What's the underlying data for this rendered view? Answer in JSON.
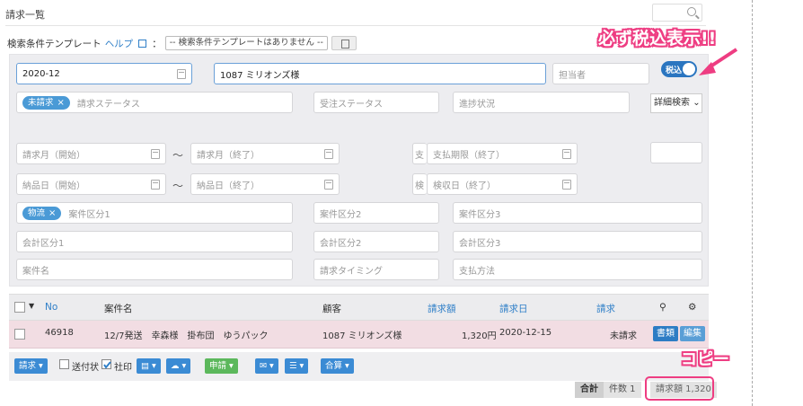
{
  "page": {
    "title": "請求一覧"
  },
  "template": {
    "label": "検索条件テンプレート",
    "help": "ヘルプ",
    "colon": "：",
    "select_value": "-- 検索条件テンプレートはありません --"
  },
  "filters": {
    "month": "2020-12",
    "customer": "1087 ミリオンズ様",
    "assignee_ph": "担当者",
    "status_tag": "未請求",
    "status_ph": "請求ステータス",
    "order_status_ph": "受注ステータス",
    "progress_ph": "進捗状況",
    "month_from_ph": "請求月（開始）",
    "month_to_ph": "請求月（終了）",
    "pay_cut": "支",
    "pay_due_ph": "支払期限（終了）",
    "delivery_from_ph": "納品日（開始）",
    "delivery_to_ph": "納品日（終了）",
    "inspect_cut": "検",
    "inspect_ph": "検収日（終了）",
    "category_tag": "物流",
    "cat1_ph": "案件区分1",
    "cat2_ph": "案件区分2",
    "cat3_ph": "案件区分3",
    "acc1_ph": "会計区分1",
    "acc2_ph": "会計区分2",
    "acc3_ph": "会計区分3",
    "name_ph": "案件名",
    "timing_ph": "請求タイミング",
    "payment_ph": "支払方法",
    "tilde": "〜",
    "tag_close": "×"
  },
  "tax_toggle": {
    "label": "税込"
  },
  "advanced": {
    "label": "詳細検索"
  },
  "callouts": {
    "tax": "必ず税込表示!!",
    "copy": "コピー"
  },
  "table": {
    "headers": {
      "no": "No",
      "name": "案件名",
      "customer": "顧客",
      "amount": "請求額",
      "date": "請求日",
      "status": "請求"
    },
    "rows": [
      {
        "no": "46918",
        "name": "12/7発送　幸森様　掛布団　ゆうパック",
        "customer": "1087 ミリオンズ様",
        "amount": "1,320円",
        "date": "2020-12-15",
        "status": "未請求",
        "btn1": "書類",
        "btn2": "編集"
      }
    ]
  },
  "toolbar": {
    "invoice": "請求",
    "send": "送付状",
    "seal": "社印",
    "apply": "申請",
    "merge": "合算"
  },
  "summary": {
    "total": "合計",
    "count": "件数 1",
    "amount": "請求額 1,320"
  },
  "colors": {
    "accent": "#2f7fc8",
    "callout": "#ee3d82",
    "row_bg": "#f2dde3"
  }
}
